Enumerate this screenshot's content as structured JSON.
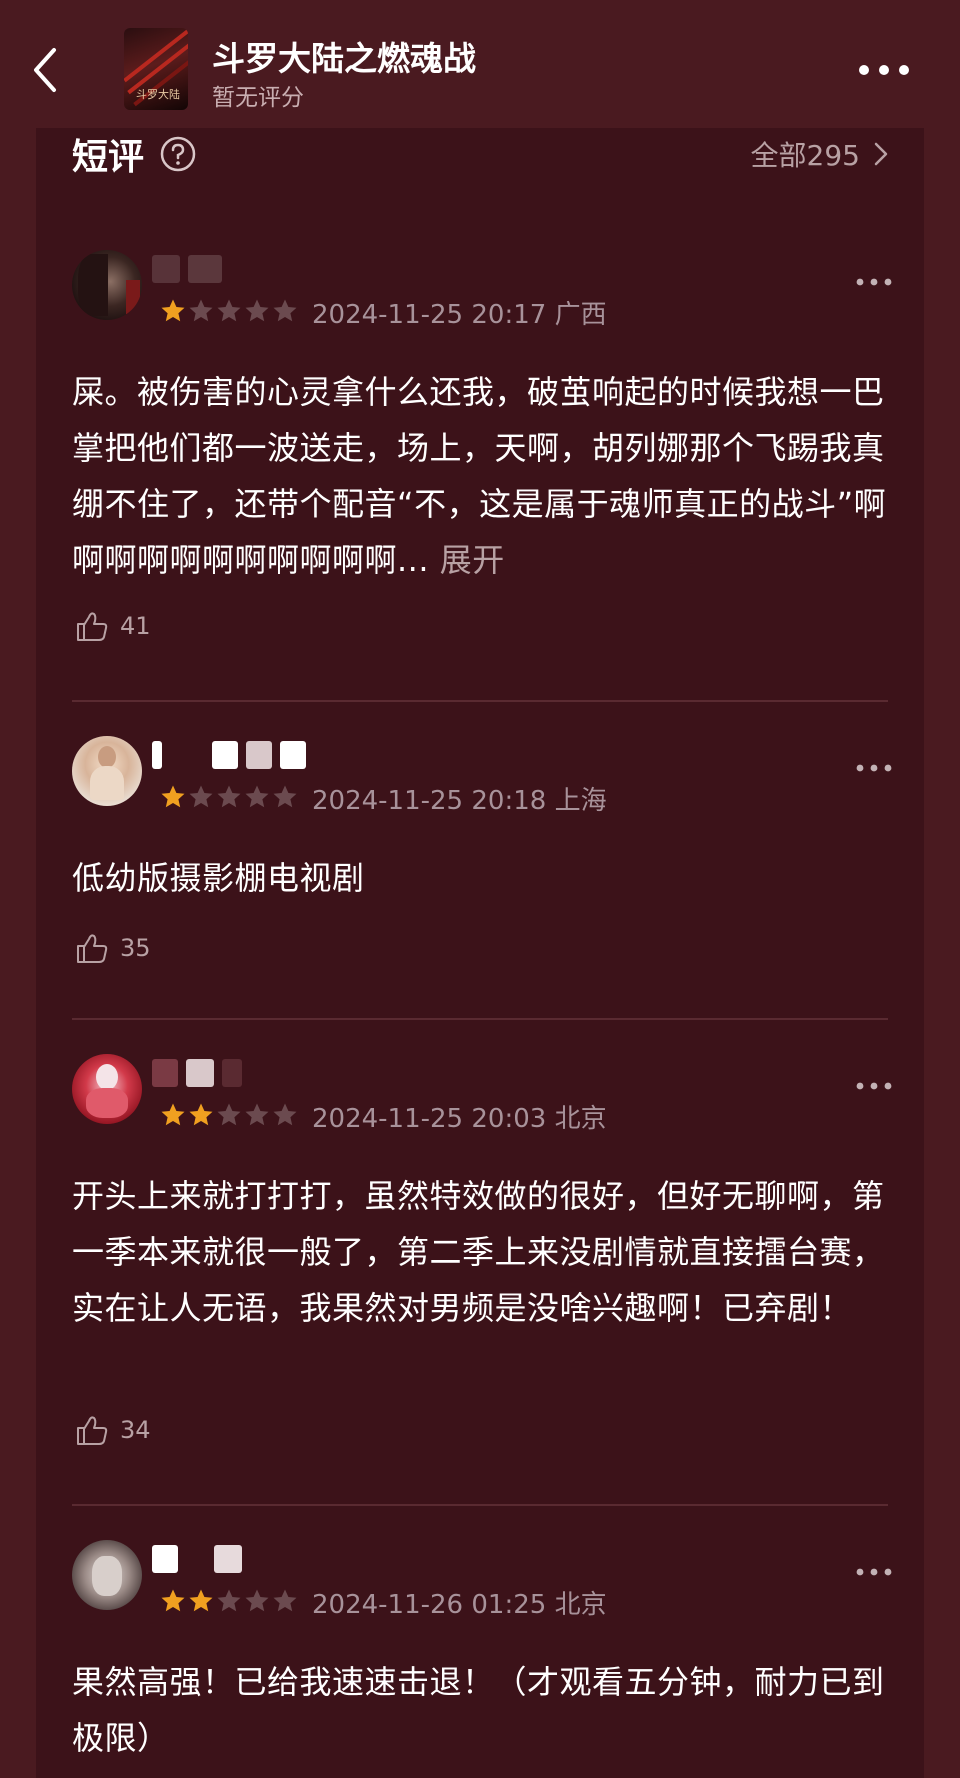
{
  "header": {
    "title": "斗罗大陆之燃魂战",
    "subtitle": "暂无评分",
    "poster_text": "斗罗大陆"
  },
  "section": {
    "title": "短评",
    "all_link": "全部295"
  },
  "colors": {
    "background": "#4a1a20",
    "panel": "#3c1219",
    "star_active": "#f0a020",
    "star_inactive": "#6b4a4f",
    "secondary_text": "#a8929a"
  },
  "reviews": [
    {
      "rating": 1,
      "date": "2024-11-25 20:17",
      "location": "广西",
      "text": "屎。被伤害的心灵拿什么还我，破茧响起的时候我想一巴掌把他们都一波送走，场上，天啊，胡列娜那个飞踢我真绷不住了，还带个配音“不，这是属于魂师真正的战斗”啊啊啊啊啊啊啊啊啊啊啊...",
      "expand": "展开",
      "likes": "41"
    },
    {
      "rating": 1,
      "date": "2024-11-25 20:18",
      "location": "上海",
      "text": "低幼版摄影棚电视剧",
      "likes": "35"
    },
    {
      "rating": 2,
      "date": "2024-11-25 20:03",
      "location": "北京",
      "text": "开头上来就打打打，虽然特效做的很好，但好无聊啊，第一季本来就很一般了，第二季上来没剧情就直接擂台赛，实在让人无语，我果然对男频是没啥兴趣啊！已弃剧！",
      "likes": "34"
    },
    {
      "rating": 2,
      "date": "2024-11-26 01:25",
      "location": "北京",
      "text": "果然高强！已给我速速击退！（才观看五分钟，耐力已到极限）",
      "likes": ""
    }
  ]
}
